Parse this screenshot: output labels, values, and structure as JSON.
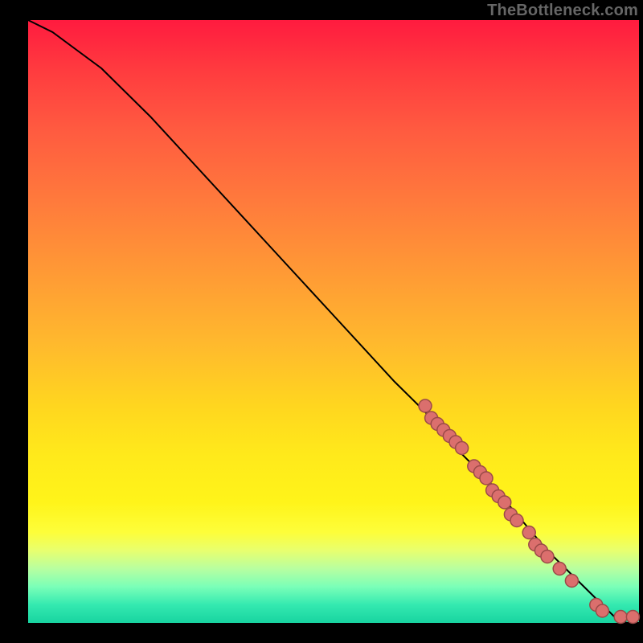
{
  "watermark": "TheBottleneck.com",
  "colors": {
    "gradient_top": "#ff1b3f",
    "gradient_mid": "#ffe91b",
    "gradient_bottom": "#18d4a0",
    "curve": "#000000",
    "point_fill": "#db6f6d",
    "point_stroke": "#9b4a48",
    "background": "#000000"
  },
  "chart_data": {
    "type": "line",
    "title": "",
    "xlabel": "",
    "ylabel": "",
    "xlim": [
      0,
      100
    ],
    "ylim": [
      0,
      100
    ],
    "series": [
      {
        "name": "curve",
        "x": [
          0,
          4,
          8,
          12,
          20,
          30,
          40,
          50,
          60,
          65,
          70,
          75,
          80,
          85,
          88,
          90,
          92,
          94,
          96,
          98,
          100
        ],
        "y": [
          100,
          98,
          95,
          92,
          84,
          73,
          62,
          51,
          40,
          35,
          29,
          24,
          18,
          12,
          9,
          7,
          5,
          3,
          1,
          0,
          0
        ]
      }
    ],
    "points": [
      {
        "x": 65,
        "y": 36
      },
      {
        "x": 66,
        "y": 34
      },
      {
        "x": 67,
        "y": 33
      },
      {
        "x": 68,
        "y": 32
      },
      {
        "x": 69,
        "y": 31
      },
      {
        "x": 70,
        "y": 30
      },
      {
        "x": 71,
        "y": 29
      },
      {
        "x": 73,
        "y": 26
      },
      {
        "x": 74,
        "y": 25
      },
      {
        "x": 75,
        "y": 24
      },
      {
        "x": 76,
        "y": 22
      },
      {
        "x": 77,
        "y": 21
      },
      {
        "x": 78,
        "y": 20
      },
      {
        "x": 79,
        "y": 18
      },
      {
        "x": 80,
        "y": 17
      },
      {
        "x": 82,
        "y": 15
      },
      {
        "x": 83,
        "y": 13
      },
      {
        "x": 84,
        "y": 12
      },
      {
        "x": 85,
        "y": 11
      },
      {
        "x": 87,
        "y": 9
      },
      {
        "x": 89,
        "y": 7
      },
      {
        "x": 93,
        "y": 3
      },
      {
        "x": 94,
        "y": 2
      },
      {
        "x": 97,
        "y": 1
      },
      {
        "x": 99,
        "y": 1
      }
    ]
  }
}
